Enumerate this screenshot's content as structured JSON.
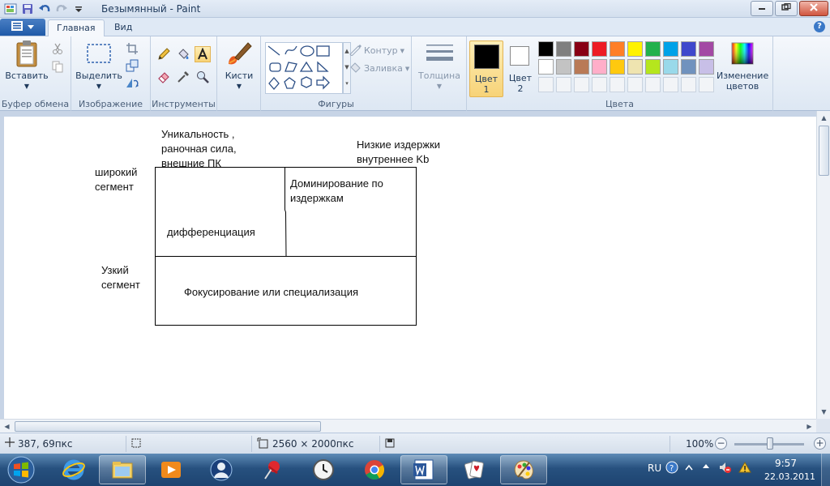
{
  "window": {
    "title": "Безымянный - Paint",
    "controls": {
      "minimize": "minimize-icon",
      "maximize": "maximize-icon",
      "close": "close-icon"
    }
  },
  "quick_access": {
    "icons": [
      "paint-icon",
      "save-icon",
      "undo-icon",
      "redo-icon",
      "customize-dropdown-icon"
    ]
  },
  "tabs": [
    {
      "label": "Главная",
      "active": true
    },
    {
      "label": "Вид",
      "active": false
    }
  ],
  "ribbon": {
    "clipboard": {
      "group_label": "Буфер обмена",
      "paste_label": "Вставить"
    },
    "image": {
      "group_label": "Изображение",
      "select_label": "Выделить"
    },
    "tools": {
      "group_label": "Инструменты"
    },
    "brushes": {
      "label": "Кисти"
    },
    "shapes": {
      "group_label": "Фигуры",
      "outline_label": "Контур",
      "fill_label": "Заливка"
    },
    "size": {
      "label": "Толщина"
    },
    "colors": {
      "group_label": "Цвета",
      "color1_label": "Цвет 1",
      "color2_label": "Цвет 2",
      "edit_colors_label": "Изменение цветов",
      "color1_value": "#000000",
      "color2_value": "#ffffff",
      "palette_row1": [
        "#000000",
        "#7f7f7f",
        "#880015",
        "#ed1c24",
        "#ff7f27",
        "#fff200",
        "#22b14c",
        "#00a2e8",
        "#3f48cc",
        "#a349a4"
      ],
      "palette_row2": [
        "#ffffff",
        "#c3c3c3",
        "#b97a57",
        "#ffaec9",
        "#ffc90e",
        "#efe4b0",
        "#b5e61d",
        "#99d9ea",
        "#7092be",
        "#c8bfe7"
      ]
    }
  },
  "canvas": {
    "texts": {
      "top_left_label": "Уникальность ,\nраночная сила,\nвнешние ПК",
      "top_right_label": "Низкие издержки\nвнутреннее Kb",
      "wide_segment": "широкий\nсегмент",
      "narrow_segment": "Узкий\nсегмент",
      "cost_leadership": "Доминирование по\nиздержкам",
      "differentiation": "дифференциация",
      "focus": "Фокусирование или специализация"
    }
  },
  "statusbar": {
    "cursor_position": "387, 69пкс",
    "image_size": "2560 × 2000пкс",
    "zoom": "100%"
  },
  "taskbar": {
    "language": "RU",
    "time": "9:57",
    "date": "22.03.2011"
  }
}
